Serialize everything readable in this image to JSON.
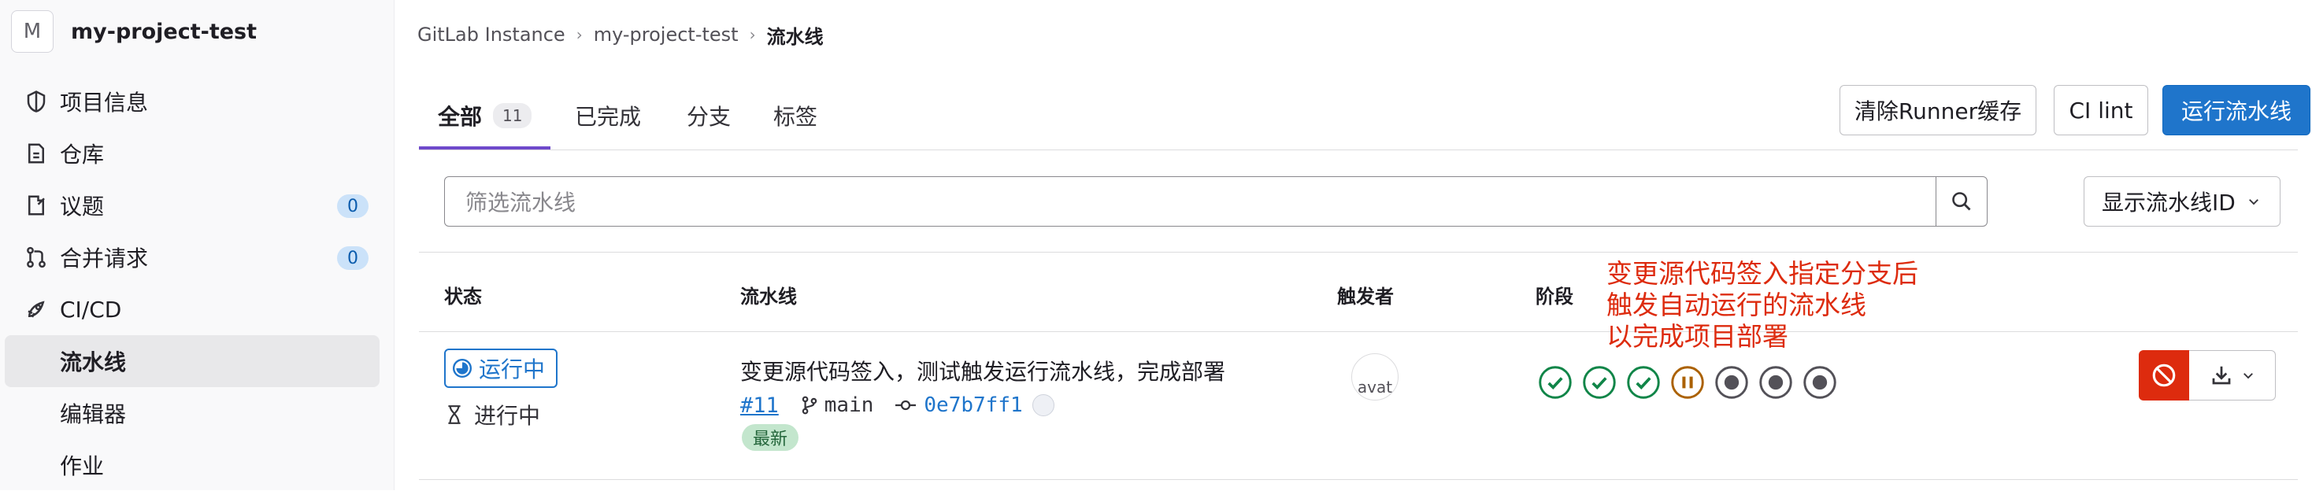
{
  "sidebar": {
    "project_initial": "M",
    "project_name": "my-project-test",
    "items": [
      {
        "label": "项目信息",
        "icon": "project-info-icon"
      },
      {
        "label": "仓库",
        "icon": "repository-icon"
      },
      {
        "label": "议题",
        "icon": "issues-icon",
        "count": "0"
      },
      {
        "label": "合并请求",
        "icon": "merge-request-icon",
        "count": "0"
      },
      {
        "label": "CI/CD",
        "icon": "rocket-icon"
      }
    ],
    "cicd_sub": [
      {
        "label": "流水线",
        "active": true
      },
      {
        "label": "编辑器"
      },
      {
        "label": "作业"
      }
    ]
  },
  "breadcrumbs": [
    "GitLab Instance",
    "my-project-test",
    "流水线"
  ],
  "tabs": [
    {
      "label": "全部",
      "count": "11",
      "active": true
    },
    {
      "label": "已完成"
    },
    {
      "label": "分支"
    },
    {
      "label": "标签"
    }
  ],
  "actions": {
    "clear_cache": "清除Runner缓存",
    "ci_lint": "CI lint",
    "run_pipeline": "运行流水线"
  },
  "filter": {
    "placeholder": "筛选流水线",
    "display_dropdown": "显示流水线ID"
  },
  "table": {
    "headers": {
      "status": "状态",
      "pipeline": "流水线",
      "triggerer": "触发者",
      "stages": "阶段"
    },
    "rows": [
      {
        "status": "运行中",
        "duration": "进行中",
        "title": "变更源代码签入，测试触发运行流水线，完成部署",
        "id": "#11",
        "branch": "main",
        "commit": "0e7b7ff1",
        "badge": "最新",
        "triggerer_avatar_alt": "avat",
        "stages": [
          "success",
          "success",
          "success",
          "running",
          "created",
          "created",
          "created"
        ]
      }
    ]
  },
  "annotation": [
    "变更源代码签入指定分支后",
    "触发自动运行的流水线",
    "以完成项目部署"
  ],
  "colors": {
    "primary": "#1f75cb",
    "danger": "#dd2b0e",
    "success": "#108548",
    "running": "#ab6100",
    "tab_active": "#6e49cb"
  }
}
